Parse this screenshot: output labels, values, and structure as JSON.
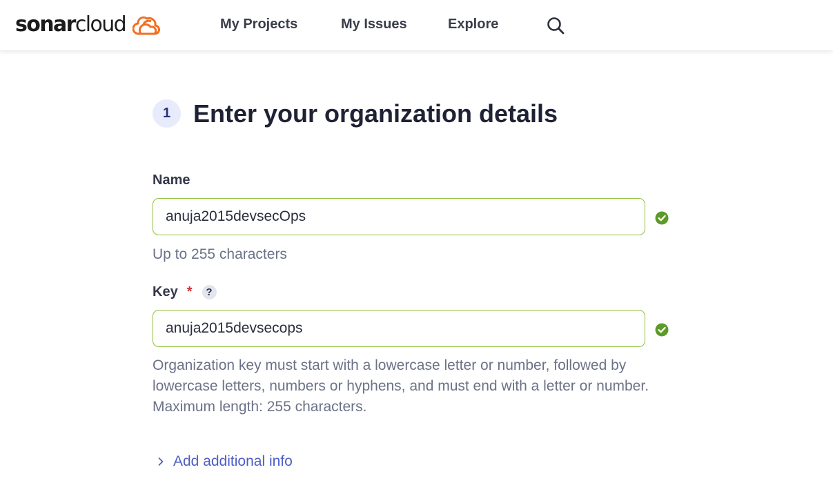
{
  "brand": {
    "name_bold": "sonar",
    "name_regular": "cloud",
    "accent_color": "#f36e21"
  },
  "nav": {
    "items": [
      {
        "label": "My Projects"
      },
      {
        "label": "My Issues"
      },
      {
        "label": "Explore"
      }
    ],
    "search_icon": "search-icon"
  },
  "step": {
    "number": "1",
    "title": "Enter your organization details"
  },
  "form": {
    "name": {
      "label": "Name",
      "value": "anuja2015devsecOps",
      "hint": "Up to 255 characters",
      "valid": true
    },
    "key": {
      "label": "Key",
      "required_marker": "*",
      "help_glyph": "?",
      "value": "anuja2015devsecops",
      "hint": "Organization key must start with a lowercase letter or number, followed by lowercase letters, numbers or hyphens, and must end with a letter or number. Maximum length: 255 characters.",
      "valid": true
    },
    "valid_color": "#5d9a27",
    "border_color": "#8fbe3a"
  },
  "additional_info": {
    "label": "Add additional info",
    "icon": "chevron-right-icon"
  }
}
